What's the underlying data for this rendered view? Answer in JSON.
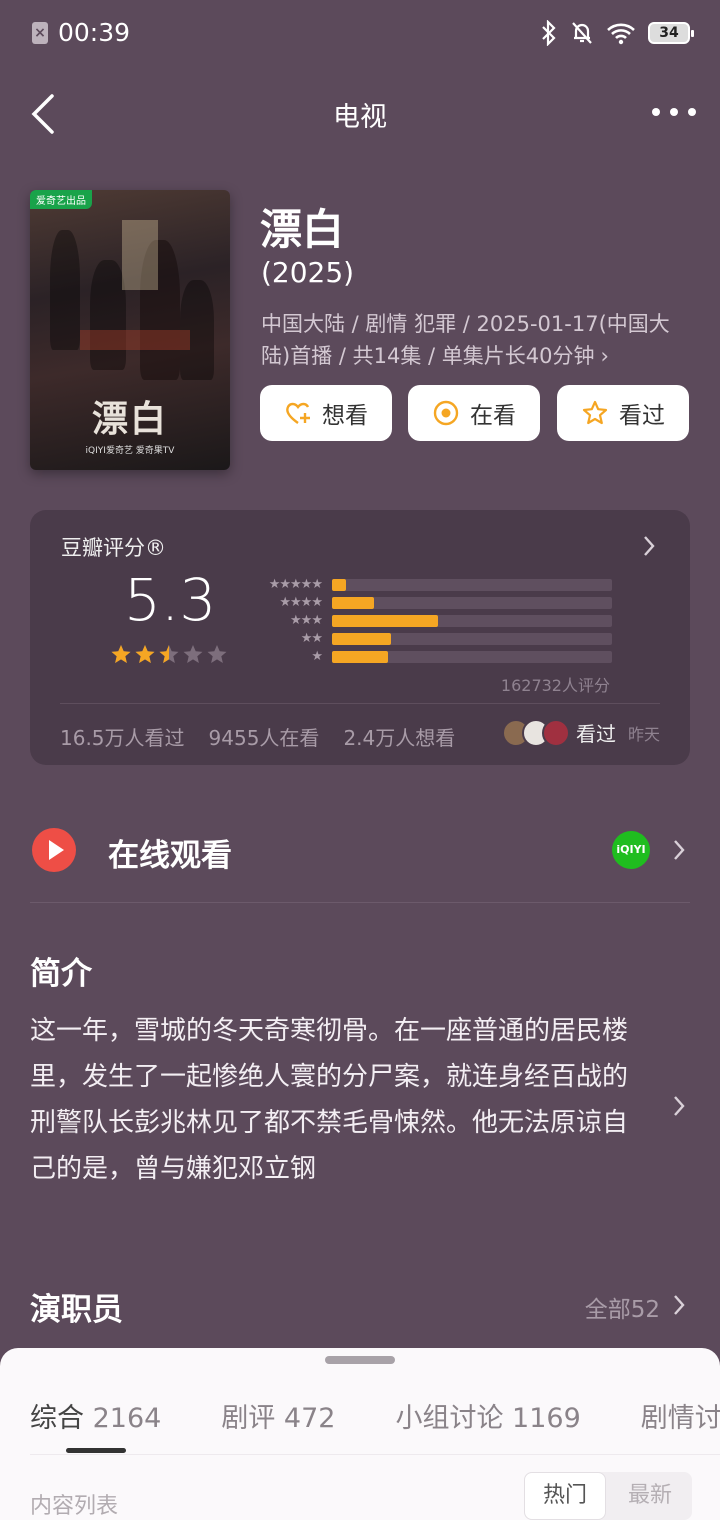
{
  "status_bar": {
    "time": "00:39",
    "battery": "34"
  },
  "nav": {
    "title": "电视"
  },
  "movie": {
    "title": "漂白",
    "year": "(2025)",
    "meta": "中国大陆 / 剧情 犯罪 / 2025-01-17(中国大陆)首播 / 共14集 / 单集片长40分钟",
    "poster": {
      "badge": "爱奇艺出品",
      "big_title": "漂白",
      "footer": "iQIYI爱奇艺  爱奇果TV"
    }
  },
  "actions": {
    "want": "想看",
    "watching": "在看",
    "watched": "看过"
  },
  "rating": {
    "label": "豆瓣评分®",
    "score": "5.3",
    "star_value": 2.5,
    "distribution": [
      {
        "stars": "★★★★★",
        "fraction": 0.05
      },
      {
        "stars": "★★★★",
        "fraction": 0.15
      },
      {
        "stars": "★★★",
        "fraction": 0.38
      },
      {
        "stars": "★★",
        "fraction": 0.21
      },
      {
        "stars": "★",
        "fraction": 0.2
      }
    ],
    "count": "162732人评分",
    "stats": {
      "seen": "16.5万人看过",
      "watching": "9455人在看",
      "want": "2.4万人想看"
    },
    "friend_status": "看过",
    "friend_time": "昨天"
  },
  "online": {
    "label": "在线观看",
    "platform": "iQIYI"
  },
  "intro": {
    "heading": "简介",
    "text": "这一年，雪城的冬天奇寒彻骨。在一座普通的居民楼里，发生了一起惨绝人寰的分尸案，就连身经百战的刑警队长彭兆林见了都不禁毛骨悚然。他无法原谅自己的是，曾与嫌犯邓立钢"
  },
  "cast": {
    "heading": "演职员",
    "all": "全部52"
  },
  "sheet": {
    "tabs": [
      {
        "label": "综合",
        "num": "2164"
      },
      {
        "label": "剧评",
        "num": "472"
      },
      {
        "label": "小组讨论",
        "num": "1169"
      },
      {
        "label": "剧情讨",
        "num": ""
      }
    ],
    "content_list": "内容列表",
    "sort_hot": "热门",
    "sort_new": "最新"
  },
  "colors": {
    "background": "#5c4a5b",
    "accent": "#f5a623",
    "play": "#ee4e46",
    "iqiyi": "#1fbd1f"
  }
}
